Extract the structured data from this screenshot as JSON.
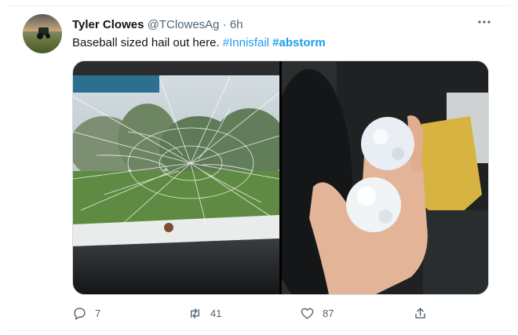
{
  "tweet": {
    "author_name": "Tyler Clowes",
    "handle": "@TClowesAg",
    "separator": "·",
    "time": "6h",
    "more_icon": "more-horizontal-icon",
    "text": "Baseball sized hail out here.",
    "hashtags": [
      "#Innisfail",
      "#abstorm"
    ],
    "media": [
      {
        "description_icon": "cracked-windshield-photo"
      },
      {
        "description_icon": "hailstones-in-hand-photo"
      }
    ],
    "actions": {
      "reply": {
        "icon": "reply-icon",
        "count": "7"
      },
      "retweet": {
        "icon": "retweet-icon",
        "count": "41"
      },
      "like": {
        "icon": "heart-icon",
        "count": "87"
      },
      "share": {
        "icon": "share-icon"
      }
    }
  },
  "colors": {
    "link": "#1d9bf0",
    "text": "#0f1419",
    "secondary": "#536471",
    "border": "#cfd9de"
  }
}
